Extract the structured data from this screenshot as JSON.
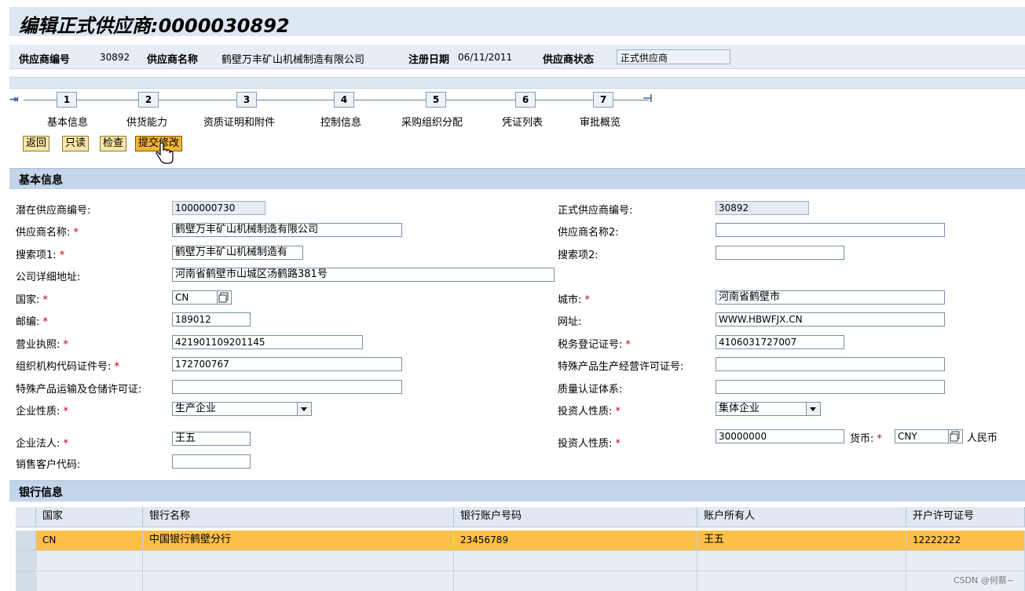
{
  "title": "编辑正式供应商:0000030892",
  "header": {
    "supplier_no_label": "供应商编号",
    "supplier_no_value": "30892",
    "supplier_name_label": "供应商名称",
    "supplier_name_value": "鹤壁万丰矿山机械制造有限公司",
    "reg_date_label": "注册日期",
    "reg_date_value": "06/11/2011",
    "status_label": "供应商状态",
    "status_value": "正式供应商"
  },
  "roadmap": {
    "steps": [
      {
        "num": "1",
        "label": "基本信息"
      },
      {
        "num": "2",
        "label": "供货能力"
      },
      {
        "num": "3",
        "label": "资质证明和附件"
      },
      {
        "num": "4",
        "label": "控制信息"
      },
      {
        "num": "5",
        "label": "采购组织分配"
      },
      {
        "num": "6",
        "label": "凭证列表"
      },
      {
        "num": "7",
        "label": "审批概览"
      }
    ]
  },
  "toolbar": {
    "back": "返回",
    "readonly": "只读",
    "check": "检查",
    "submit": "提交修改"
  },
  "basic": {
    "section_title": "基本信息",
    "req": "*",
    "potential_no_label": "潜在供应商编号:",
    "potential_no_value": "1000000730",
    "formal_no_label": "正式供应商编号:",
    "formal_no_value": "30892",
    "name_label": "供应商名称:",
    "name_value": "鹤壁万丰矿山机械制造有限公司",
    "name2_label": "供应商名称2:",
    "name2_value": "",
    "search1_label": "搜索项1:",
    "search1_value": "鹤壁万丰矿山机械制造有",
    "search2_label": "搜索项2:",
    "search2_value": "",
    "address_label": "公司详细地址:",
    "address_value": "河南省鹤壁市山城区汤鹤路381号",
    "country_label": "国家:",
    "country_value": "CN",
    "city_label": "城市:",
    "city_value": "河南省鹤壁市",
    "zip_label": "邮编:",
    "zip_value": "189012",
    "website_label": "网址:",
    "website_value": "WWW.HBWFJX.CN",
    "license_label": "营业执照:",
    "license_value": "421901109201145",
    "tax_label": "税务登记证号:",
    "tax_value": "4106031727007",
    "org_code_label": "组织机构代码证件号:",
    "org_code_value": "172700767",
    "special_prod_label": "特殊产品生产经营许可证号:",
    "special_prod_value": "",
    "special_trans_label": "特殊产品运输及仓储许可证:",
    "special_trans_value": "",
    "quality_label": "质量认证体系:",
    "quality_value": "",
    "enterprise_type_label": "企业性质:",
    "enterprise_type_value": "生产企业",
    "investor_type_label": "投资人性质:",
    "investor_type_value": "集体企业",
    "legal_person_label": "企业法人:",
    "legal_person_value": "王五",
    "investor_amount_label": "投资人性质:",
    "investor_amount_value": "30000000",
    "currency_label": "货币:",
    "currency_value": "CNY",
    "currency_text": "人民币",
    "sales_code_label": "销售客户代码:",
    "sales_code_value": ""
  },
  "bank": {
    "section_title": "银行信息",
    "columns": [
      "国家",
      "银行名称",
      "银行账户号码",
      "账户所有人",
      "开户许可证号"
    ],
    "rows": [
      [
        "CN",
        "中国银行鹤壁分行",
        "23456789",
        "王五",
        "12222222"
      ]
    ]
  },
  "watermark": "CSDN @何蔡~"
}
